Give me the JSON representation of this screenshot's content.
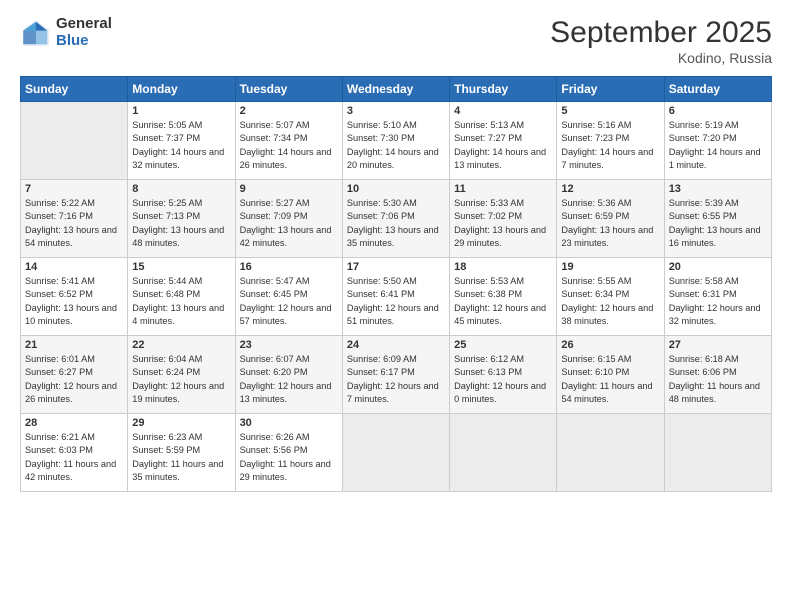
{
  "header": {
    "logo": {
      "general": "General",
      "blue": "Blue"
    },
    "title": "September 2025",
    "location": "Kodino, Russia"
  },
  "weekdays": [
    "Sunday",
    "Monday",
    "Tuesday",
    "Wednesday",
    "Thursday",
    "Friday",
    "Saturday"
  ],
  "weeks": [
    [
      {
        "day": "",
        "empty": true
      },
      {
        "day": "1",
        "sunrise": "Sunrise: 5:05 AM",
        "sunset": "Sunset: 7:37 PM",
        "daylight": "Daylight: 14 hours and 32 minutes."
      },
      {
        "day": "2",
        "sunrise": "Sunrise: 5:07 AM",
        "sunset": "Sunset: 7:34 PM",
        "daylight": "Daylight: 14 hours and 26 minutes."
      },
      {
        "day": "3",
        "sunrise": "Sunrise: 5:10 AM",
        "sunset": "Sunset: 7:30 PM",
        "daylight": "Daylight: 14 hours and 20 minutes."
      },
      {
        "day": "4",
        "sunrise": "Sunrise: 5:13 AM",
        "sunset": "Sunset: 7:27 PM",
        "daylight": "Daylight: 14 hours and 13 minutes."
      },
      {
        "day": "5",
        "sunrise": "Sunrise: 5:16 AM",
        "sunset": "Sunset: 7:23 PM",
        "daylight": "Daylight: 14 hours and 7 minutes."
      },
      {
        "day": "6",
        "sunrise": "Sunrise: 5:19 AM",
        "sunset": "Sunset: 7:20 PM",
        "daylight": "Daylight: 14 hours and 1 minute."
      }
    ],
    [
      {
        "day": "7",
        "sunrise": "Sunrise: 5:22 AM",
        "sunset": "Sunset: 7:16 PM",
        "daylight": "Daylight: 13 hours and 54 minutes."
      },
      {
        "day": "8",
        "sunrise": "Sunrise: 5:25 AM",
        "sunset": "Sunset: 7:13 PM",
        "daylight": "Daylight: 13 hours and 48 minutes."
      },
      {
        "day": "9",
        "sunrise": "Sunrise: 5:27 AM",
        "sunset": "Sunset: 7:09 PM",
        "daylight": "Daylight: 13 hours and 42 minutes."
      },
      {
        "day": "10",
        "sunrise": "Sunrise: 5:30 AM",
        "sunset": "Sunset: 7:06 PM",
        "daylight": "Daylight: 13 hours and 35 minutes."
      },
      {
        "day": "11",
        "sunrise": "Sunrise: 5:33 AM",
        "sunset": "Sunset: 7:02 PM",
        "daylight": "Daylight: 13 hours and 29 minutes."
      },
      {
        "day": "12",
        "sunrise": "Sunrise: 5:36 AM",
        "sunset": "Sunset: 6:59 PM",
        "daylight": "Daylight: 13 hours and 23 minutes."
      },
      {
        "day": "13",
        "sunrise": "Sunrise: 5:39 AM",
        "sunset": "Sunset: 6:55 PM",
        "daylight": "Daylight: 13 hours and 16 minutes."
      }
    ],
    [
      {
        "day": "14",
        "sunrise": "Sunrise: 5:41 AM",
        "sunset": "Sunset: 6:52 PM",
        "daylight": "Daylight: 13 hours and 10 minutes."
      },
      {
        "day": "15",
        "sunrise": "Sunrise: 5:44 AM",
        "sunset": "Sunset: 6:48 PM",
        "daylight": "Daylight: 13 hours and 4 minutes."
      },
      {
        "day": "16",
        "sunrise": "Sunrise: 5:47 AM",
        "sunset": "Sunset: 6:45 PM",
        "daylight": "Daylight: 12 hours and 57 minutes."
      },
      {
        "day": "17",
        "sunrise": "Sunrise: 5:50 AM",
        "sunset": "Sunset: 6:41 PM",
        "daylight": "Daylight: 12 hours and 51 minutes."
      },
      {
        "day": "18",
        "sunrise": "Sunrise: 5:53 AM",
        "sunset": "Sunset: 6:38 PM",
        "daylight": "Daylight: 12 hours and 45 minutes."
      },
      {
        "day": "19",
        "sunrise": "Sunrise: 5:55 AM",
        "sunset": "Sunset: 6:34 PM",
        "daylight": "Daylight: 12 hours and 38 minutes."
      },
      {
        "day": "20",
        "sunrise": "Sunrise: 5:58 AM",
        "sunset": "Sunset: 6:31 PM",
        "daylight": "Daylight: 12 hours and 32 minutes."
      }
    ],
    [
      {
        "day": "21",
        "sunrise": "Sunrise: 6:01 AM",
        "sunset": "Sunset: 6:27 PM",
        "daylight": "Daylight: 12 hours and 26 minutes."
      },
      {
        "day": "22",
        "sunrise": "Sunrise: 6:04 AM",
        "sunset": "Sunset: 6:24 PM",
        "daylight": "Daylight: 12 hours and 19 minutes."
      },
      {
        "day": "23",
        "sunrise": "Sunrise: 6:07 AM",
        "sunset": "Sunset: 6:20 PM",
        "daylight": "Daylight: 12 hours and 13 minutes."
      },
      {
        "day": "24",
        "sunrise": "Sunrise: 6:09 AM",
        "sunset": "Sunset: 6:17 PM",
        "daylight": "Daylight: 12 hours and 7 minutes."
      },
      {
        "day": "25",
        "sunrise": "Sunrise: 6:12 AM",
        "sunset": "Sunset: 6:13 PM",
        "daylight": "Daylight: 12 hours and 0 minutes."
      },
      {
        "day": "26",
        "sunrise": "Sunrise: 6:15 AM",
        "sunset": "Sunset: 6:10 PM",
        "daylight": "Daylight: 11 hours and 54 minutes."
      },
      {
        "day": "27",
        "sunrise": "Sunrise: 6:18 AM",
        "sunset": "Sunset: 6:06 PM",
        "daylight": "Daylight: 11 hours and 48 minutes."
      }
    ],
    [
      {
        "day": "28",
        "sunrise": "Sunrise: 6:21 AM",
        "sunset": "Sunset: 6:03 PM",
        "daylight": "Daylight: 11 hours and 42 minutes."
      },
      {
        "day": "29",
        "sunrise": "Sunrise: 6:23 AM",
        "sunset": "Sunset: 5:59 PM",
        "daylight": "Daylight: 11 hours and 35 minutes."
      },
      {
        "day": "30",
        "sunrise": "Sunrise: 6:26 AM",
        "sunset": "Sunset: 5:56 PM",
        "daylight": "Daylight: 11 hours and 29 minutes."
      },
      {
        "day": "",
        "empty": true
      },
      {
        "day": "",
        "empty": true
      },
      {
        "day": "",
        "empty": true
      },
      {
        "day": "",
        "empty": true
      }
    ]
  ]
}
